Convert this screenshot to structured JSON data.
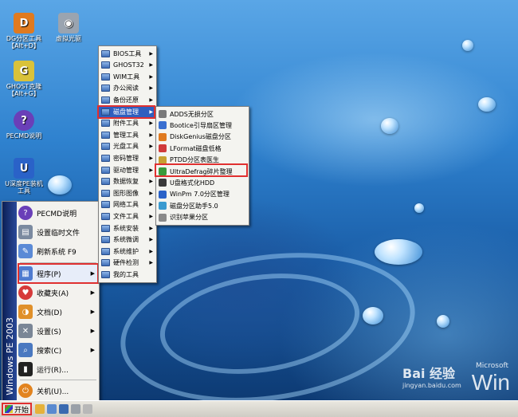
{
  "desktop": {
    "icons": [
      {
        "label": "DG分区工具\n【Alt+D】",
        "glyph": "D",
        "color": "#e07a1f"
      },
      {
        "label": "虚拟光驱",
        "glyph": "◉",
        "color": "#9aa4b0"
      },
      {
        "label": "GHOST克隆\n【Alt+G】",
        "glyph": "G",
        "color": "#d9c23a"
      },
      {
        "label": "PECMD说明",
        "glyph": "?",
        "color": "#6a3fb8"
      },
      {
        "label": "U深度PE装机\n工具",
        "glyph": "U",
        "color": "#2a62c8"
      }
    ],
    "logo_text": "Win",
    "logo_small": "Microsoft",
    "watermark": "Bai 经验",
    "watermark_url": "jingyan.baidu.com"
  },
  "start_menu": {
    "side_label": "Windows PE 2003",
    "items": [
      {
        "label": "PECMD说明",
        "glyph": "?",
        "color": "#6a3fb8",
        "arrow": ""
      },
      {
        "label": "设置临时文件",
        "glyph": "▤",
        "color": "#7b8aa0",
        "arrow": ""
      },
      {
        "label": "刷新系统 F9",
        "glyph": "✎",
        "color": "#5b8ad6",
        "arrow": ""
      },
      {
        "label": "程序(P)",
        "glyph": "▦",
        "color": "#4f7bd0",
        "arrow": "▶"
      },
      {
        "label": "收藏夹(A)",
        "glyph": "♥",
        "color": "#d63a3a",
        "arrow": "▶"
      },
      {
        "label": "文档(D)",
        "glyph": "◑",
        "color": "#e0902a",
        "arrow": "▶"
      },
      {
        "label": "设置(S)",
        "glyph": "✕",
        "color": "#7a8696",
        "arrow": "▶"
      },
      {
        "label": "搜索(C)",
        "glyph": "⌕",
        "color": "#4a78c0",
        "arrow": "▶"
      },
      {
        "label": "运行(R)...",
        "glyph": "▮",
        "color": "#222222",
        "arrow": ""
      },
      {
        "label": "关机(U)...",
        "glyph": "⏻",
        "color": "#e2831e",
        "arrow": ""
      }
    ]
  },
  "programs_menu": {
    "items": [
      "BIOS工具",
      "GHOST32",
      "WIM工具",
      "办公阅读",
      "备份还原",
      "磁盘管理",
      "附件工具",
      "管理工具",
      "光盘工具",
      "密码管理",
      "驱动管理",
      "数据恢复",
      "图形图像",
      "网络工具",
      "文件工具",
      "系统安装",
      "系统微调",
      "系统维护",
      "硬件检测",
      "我的工具"
    ],
    "arrow": "▶"
  },
  "disk_menu": {
    "items": [
      {
        "label": "ADDS无损分区",
        "color": "#7a7a7a"
      },
      {
        "label": "Bootice引导扇区管理",
        "color": "#3a6fd0"
      },
      {
        "label": "DiskGenius磁盘分区",
        "color": "#e07a1f"
      },
      {
        "label": "LFormat磁盘低格",
        "color": "#d03a3a"
      },
      {
        "label": "PTDD分区表医生",
        "color": "#c8a030"
      },
      {
        "label": "UltraDefrag碎片整理",
        "color": "#3a9a3a"
      },
      {
        "label": "U盘格式化HDD",
        "color": "#3a3a3a"
      },
      {
        "label": "WinPm 7.0分区管理",
        "color": "#2a62c8"
      },
      {
        "label": "磁盘分区助手5.0",
        "color": "#3a9ad0"
      },
      {
        "label": "识别苹果分区",
        "color": "#8a8a8a"
      }
    ]
  },
  "taskbar": {
    "start_label": "开始"
  }
}
